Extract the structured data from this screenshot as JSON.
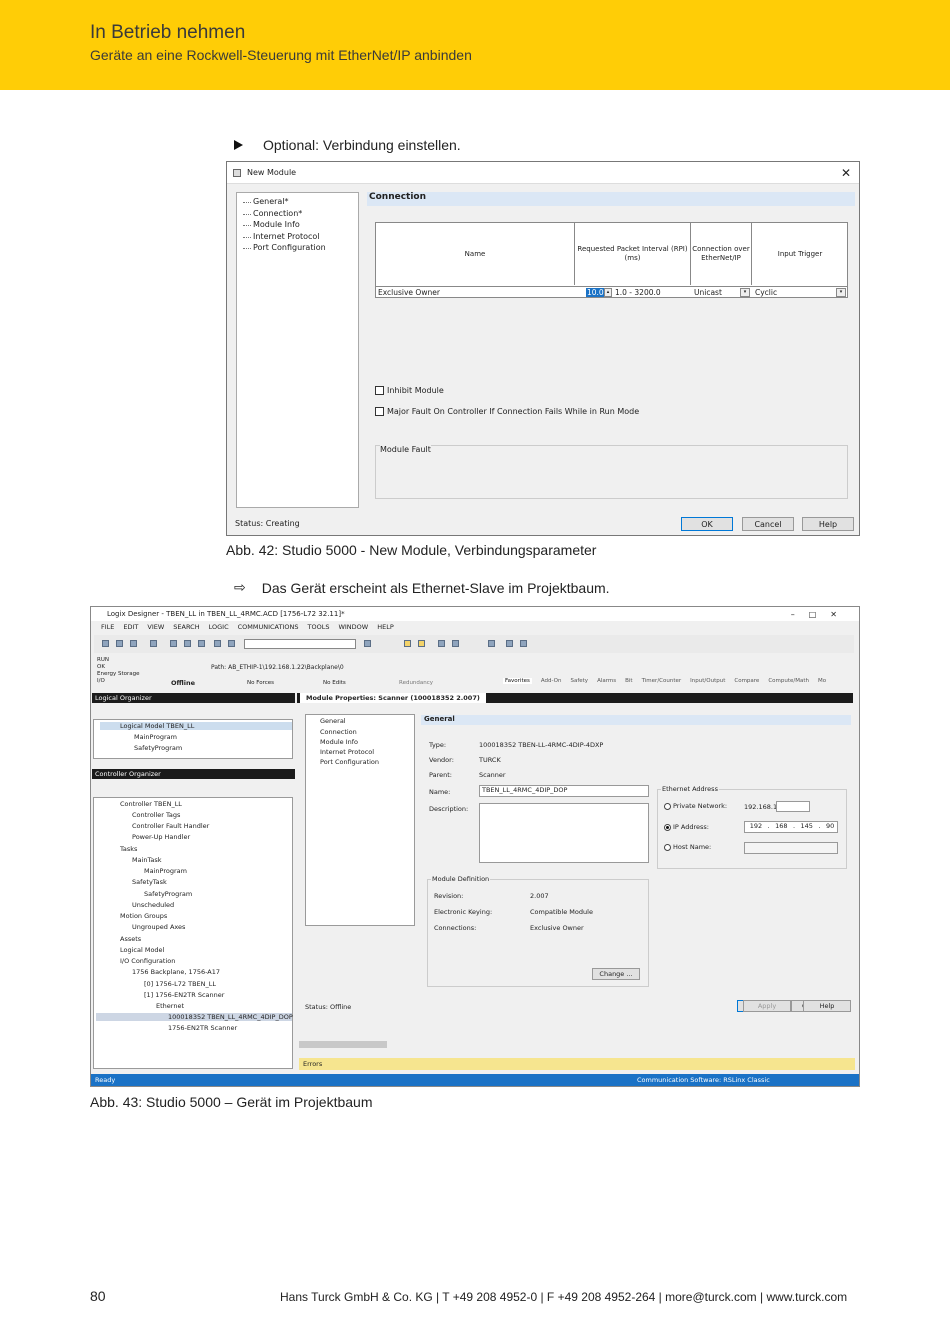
{
  "header": {
    "title": "In Betrieb nehmen",
    "subtitle": "Geräte an eine Rockwell-Steuerung mit EtherNet/IP anbinden"
  },
  "step": "Optional: Verbindung einstellen.",
  "dialog1": {
    "title": "New Module",
    "nav": [
      "General*",
      "Connection*",
      "Module Info",
      "Internet Protocol",
      "Port Configuration"
    ],
    "section": "Connection",
    "table": {
      "headers": [
        "Name",
        "Requested Packet Interval (RPI)\n(ms)",
        "Connection over\nEtherNet/IP",
        "Input Trigger"
      ],
      "row": {
        "name": "Exclusive Owner",
        "rpi": "10.0",
        "range": "1.0 - 3200.0",
        "conn": "Unicast",
        "trigger": "Cyclic"
      }
    },
    "inhibit": "Inhibit Module",
    "major": "Major Fault On Controller If Connection Fails While in Run Mode",
    "fault": "Module Fault",
    "status": "Status:  Creating",
    "ok": "OK",
    "cancel": "Cancel",
    "help": "Help"
  },
  "caption1": "Abb. 42: Studio 5000 - New Module, Verbindungsparameter",
  "result": "Das Gerät erscheint als Ethernet-Slave im Projektbaum.",
  "app": {
    "title": "Logix Designer - TBEN_LL in TBEN_LL_4RMC.ACD [1756-L72 32.11]*",
    "menu": [
      "FILE",
      "EDIT",
      "VIEW",
      "SEARCH",
      "LOGIC",
      "COMMUNICATIONS",
      "TOOLS",
      "WINDOW",
      "HELP"
    ],
    "state": [
      "RUN",
      "OK",
      "Energy Storage",
      "I/O"
    ],
    "offline": "Offline",
    "noforces": "No Forces",
    "noedits": "No Edits",
    "redundancy": "Redundancy",
    "path": "Path: AB_ETHIP-1\\192.168.1.22\\Backplane\\0",
    "tabs": [
      "Favorites",
      "Add-On",
      "Safety",
      "Alarms",
      "Bit",
      "Timer/Counter",
      "Input/Output",
      "Compare",
      "Compute/Math",
      "Mo"
    ],
    "logical": {
      "title": "Logical Organizer",
      "items": [
        "Logical Model TBEN_LL",
        "MainProgram",
        "SafetyProgram"
      ]
    },
    "controller": {
      "title": "Controller Organizer",
      "items": [
        "Controller TBEN_LL",
        "Controller Tags",
        "Controller Fault Handler",
        "Power-Up Handler",
        "Tasks",
        "MainTask",
        "MainProgram",
        "SafetyTask",
        "SafetyProgram",
        "Unscheduled",
        "Motion Groups",
        "Ungrouped Axes",
        "Assets",
        "Logical Model",
        "I/O Configuration",
        "1756 Backplane, 1756-A17",
        "[0] 1756-L72 TBEN_LL",
        "[1] 1756-EN2TR Scanner",
        "Ethernet",
        "100018352 TBEN_LL_4RMC_4DIP_DOP",
        "1756-EN2TR Scanner"
      ]
    },
    "mp_tab": "Module Properties: Scanner (100018352 2.007)",
    "mp_nav": [
      "General",
      "Connection",
      "Module Info",
      "Internet Protocol",
      "Port Configuration"
    ],
    "general": "General",
    "type_l": "Type:",
    "type_v": "100018352 TBEN-LL-4RMC-4DIP-4DXP",
    "vendor_l": "Vendor:",
    "vendor_v": "TURCK",
    "parent_l": "Parent:",
    "parent_v": "Scanner",
    "name_l": "Name:",
    "name_v": "TBEN_LL_4RMC_4DIP_DOP",
    "desc_l": "Description:",
    "eth": "Ethernet Address",
    "private": "Private Network:",
    "private_v": "192.168.1.",
    "ip": "IP Address:",
    "ip_v": [
      "192",
      "168",
      "145",
      "90"
    ],
    "host": "Host Name:",
    "moddef": "Module Definition",
    "rev_l": "Revision:",
    "rev_v": "2.007",
    "key_l": "Electronic Keying:",
    "key_v": "Compatible Module",
    "con_l": "Connections:",
    "con_v": "Exclusive Owner",
    "change": "Change ...",
    "status": "Status:  Offline",
    "ok": "OK",
    "cancel": "Cancel",
    "apply": "Apply",
    "help": "Help",
    "errors": "Errors",
    "ready": "Ready",
    "comm": "Communication Software: RSLinx Classic"
  },
  "caption2": "Abb. 43: Studio 5000 – Gerät im Projektbaum",
  "footer": {
    "page": "80",
    "text": "Hans Turck GmbH & Co. KG | T +49 208 4952-0 | F +49 208 4952-264 | more@turck.com | www.turck.com"
  },
  "colors": {
    "brand": "#ffcd06",
    "accent": "#1a72c6"
  }
}
